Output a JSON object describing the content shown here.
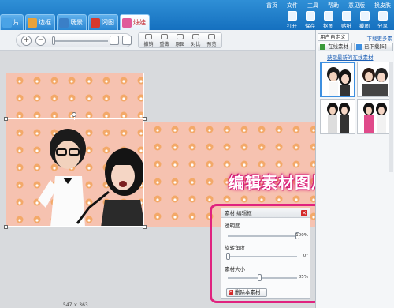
{
  "tabs": [
    {
      "label": "片",
      "color": "#4aa3e6"
    },
    {
      "label": "边框",
      "color": "#e8a23a"
    },
    {
      "label": "场景",
      "color": "#3a7fc7"
    },
    {
      "label": "闪图",
      "color": "#d6392e"
    },
    {
      "label": "烛娃",
      "color": "#e05a9a"
    }
  ],
  "menu": [
    "首页",
    "文件",
    "工具",
    "帮助",
    "意见版",
    "换皮肤"
  ],
  "right_buttons": [
    "打开",
    "保存",
    "抠图",
    "贴纸",
    "截图",
    "分享"
  ],
  "toolbar": {
    "tools": [
      "撤销",
      "重做",
      "原图",
      "对比",
      "预览"
    ]
  },
  "edit_label": "编辑素材图片",
  "dialog": {
    "title": "素材 编辑框",
    "opacity_label": "透明度",
    "opacity_value": "100%",
    "opacity_level": 1.0,
    "rotate_label": "旋转角度",
    "rotate_value": "0°",
    "rotate_level": 0.0,
    "size_label": "素材大小",
    "size_value": "85%",
    "size_level": 0.45,
    "delete_label": "删除本素材"
  },
  "rpanel": {
    "select": "用户自定义",
    "more": "下载更多素",
    "tab_online": "在线素材",
    "tab_downloaded": "已下载[5]",
    "link": "获取最新的在线素材"
  },
  "status": "547 × 363"
}
